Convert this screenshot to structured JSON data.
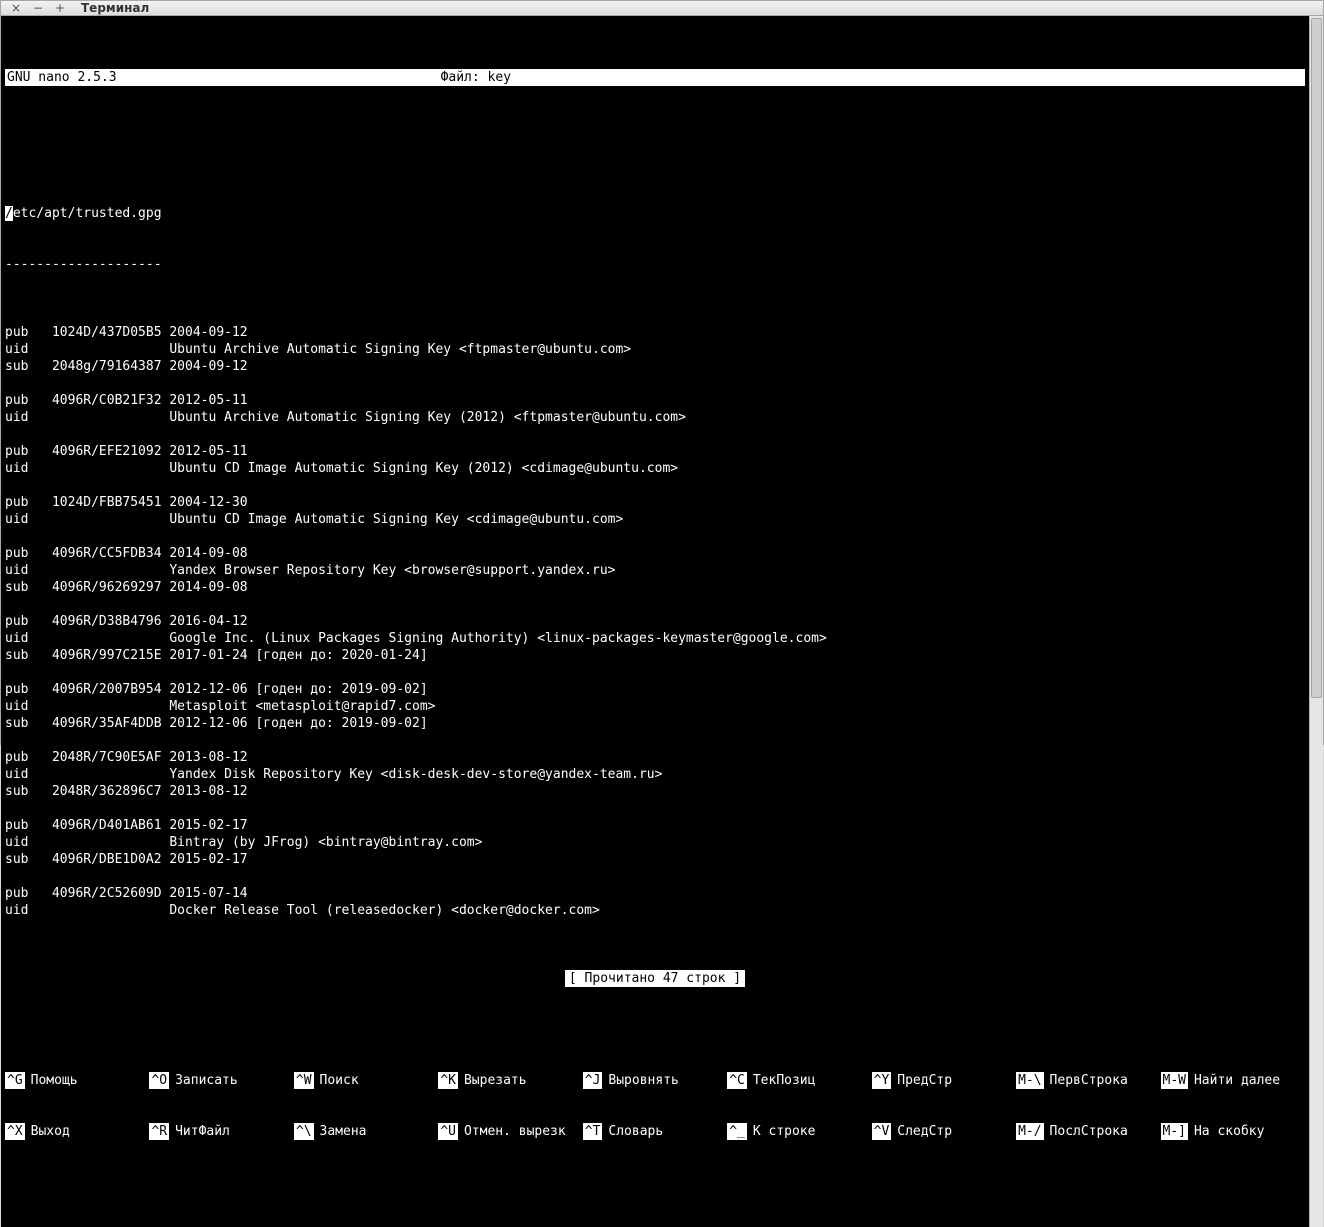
{
  "window": {
    "title": "Терминал"
  },
  "header": {
    "app": "GNU nano 2.5.3",
    "file_label": "Файл: key"
  },
  "content": {
    "path": "/etc/apt/trusted.gpg",
    "separator": "--------------------",
    "blocks": [
      [
        "pub   1024D/437D05B5 2004-09-12",
        "uid                  Ubuntu Archive Automatic Signing Key <ftpmaster@ubuntu.com>",
        "sub   2048g/79164387 2004-09-12"
      ],
      [
        "pub   4096R/C0B21F32 2012-05-11",
        "uid                  Ubuntu Archive Automatic Signing Key (2012) <ftpmaster@ubuntu.com>"
      ],
      [
        "pub   4096R/EFE21092 2012-05-11",
        "uid                  Ubuntu CD Image Automatic Signing Key (2012) <cdimage@ubuntu.com>"
      ],
      [
        "pub   1024D/FBB75451 2004-12-30",
        "uid                  Ubuntu CD Image Automatic Signing Key <cdimage@ubuntu.com>"
      ],
      [
        "pub   4096R/CC5FDB34 2014-09-08",
        "uid                  Yandex Browser Repository Key <browser@support.yandex.ru>",
        "sub   4096R/96269297 2014-09-08"
      ],
      [
        "pub   4096R/D38B4796 2016-04-12",
        "uid                  Google Inc. (Linux Packages Signing Authority) <linux-packages-keymaster@google.com>",
        "sub   4096R/997C215E 2017-01-24 [годен до: 2020-01-24]"
      ],
      [
        "pub   4096R/2007B954 2012-12-06 [годен до: 2019-09-02]",
        "uid                  Metasploit <metasploit@rapid7.com>",
        "sub   4096R/35AF4DDB 2012-12-06 [годен до: 2019-09-02]"
      ],
      [
        "pub   2048R/7C90E5AF 2013-08-12",
        "uid                  Yandex Disk Repository Key <disk-desk-dev-store@yandex-team.ru>",
        "sub   2048R/362896C7 2013-08-12"
      ],
      [
        "pub   4096R/D401AB61 2015-02-17",
        "uid                  Bintray (by JFrog) <bintray@bintray.com>",
        "sub   4096R/DBE1D0A2 2015-02-17"
      ],
      [
        "pub   4096R/2C52609D 2015-07-14",
        "uid                  Docker Release Tool (releasedocker) <docker@docker.com>"
      ]
    ]
  },
  "status": "[ Прочитано 47 строк ]",
  "shortcuts": {
    "row1": [
      {
        "key": "^G",
        "label": "Помощь"
      },
      {
        "key": "^O",
        "label": "Записать"
      },
      {
        "key": "^W",
        "label": "Поиск"
      },
      {
        "key": "^K",
        "label": "Вырезать"
      },
      {
        "key": "^J",
        "label": "Выровнять"
      },
      {
        "key": "^C",
        "label": "ТекПозиц"
      },
      {
        "key": "^Y",
        "label": "ПредСтр"
      },
      {
        "key": "M-\\",
        "label": "ПервСтрока"
      },
      {
        "key": "M-W",
        "label": "Найти далее"
      }
    ],
    "row2": [
      {
        "key": "^X",
        "label": "Выход"
      },
      {
        "key": "^R",
        "label": "ЧитФайл"
      },
      {
        "key": "^\\",
        "label": "Замена"
      },
      {
        "key": "^U",
        "label": "Отмен. вырезк"
      },
      {
        "key": "^T",
        "label": "Словарь"
      },
      {
        "key": "^_",
        "label": "К строке"
      },
      {
        "key": "^V",
        "label": "СледСтр"
      },
      {
        "key": "M-/",
        "label": "ПослСтрока"
      },
      {
        "key": "M-]",
        "label": "На скобку"
      }
    ]
  }
}
